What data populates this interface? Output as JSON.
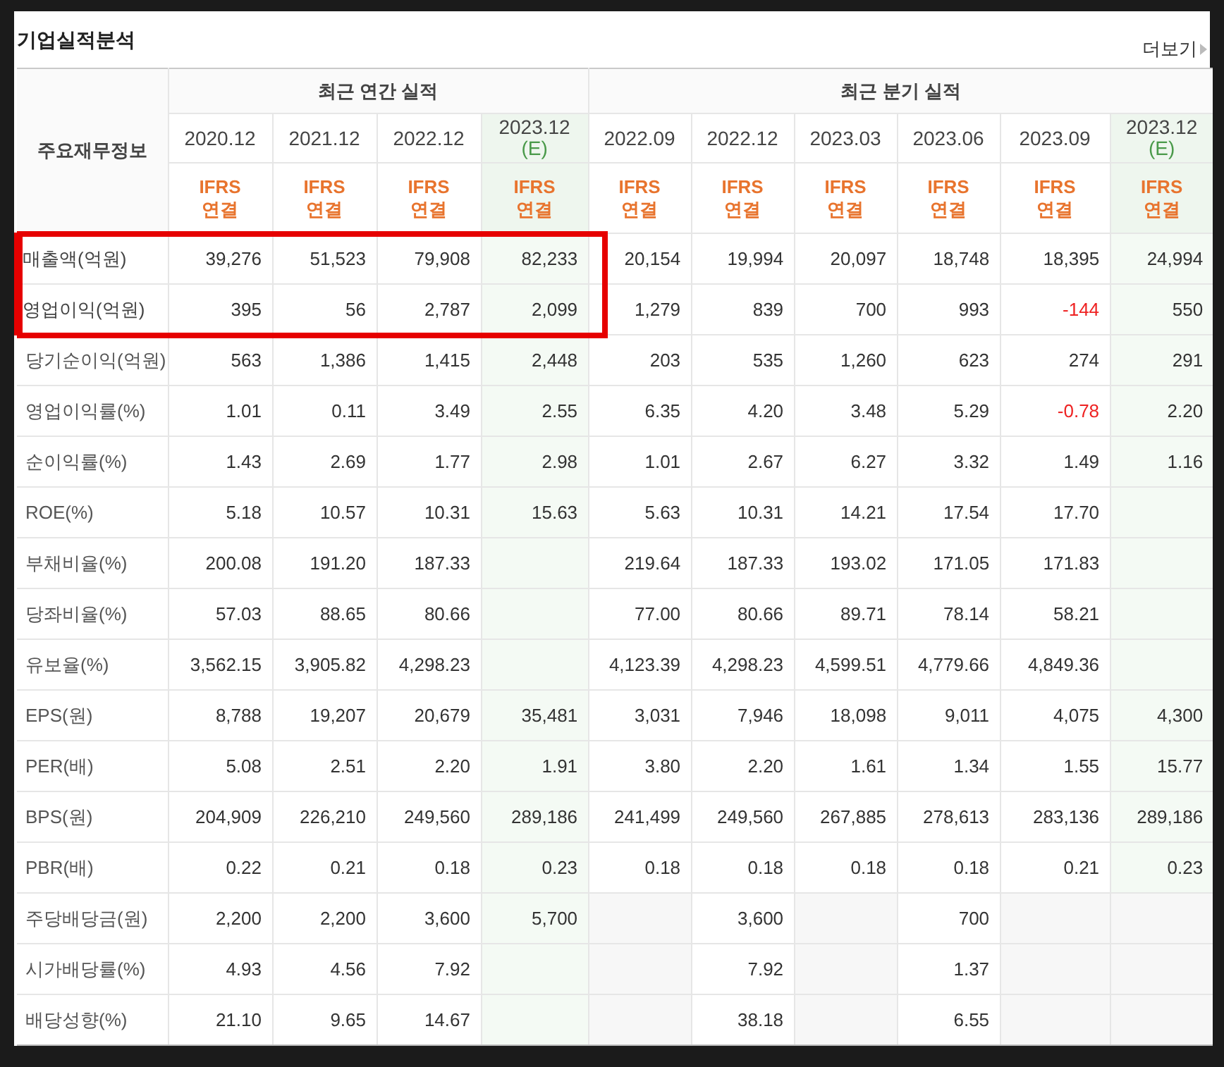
{
  "section": {
    "title": "기업실적분석",
    "more_link": "더보기"
  },
  "table": {
    "corner_label": "주요재무정보",
    "column_groups": [
      {
        "label": "최근 연간 실적",
        "columns": [
          {
            "period": "2020.12",
            "estimate": false,
            "basis": "IFRS 연결"
          },
          {
            "period": "2021.12",
            "estimate": false,
            "basis": "IFRS 연결"
          },
          {
            "period": "2022.12",
            "estimate": false,
            "basis": "IFRS 연결"
          },
          {
            "period": "2023.12",
            "estimate": true,
            "estimate_mark": "(E)",
            "basis": "IFRS 연결"
          }
        ]
      },
      {
        "label": "최근 분기 실적",
        "columns": [
          {
            "period": "2022.09",
            "estimate": false,
            "basis": "IFRS 연결"
          },
          {
            "period": "2022.12",
            "estimate": false,
            "basis": "IFRS 연결"
          },
          {
            "period": "2023.03",
            "estimate": false,
            "basis": "IFRS 연결"
          },
          {
            "period": "2023.06",
            "estimate": false,
            "basis": "IFRS 연결"
          },
          {
            "period": "2023.09",
            "estimate": false,
            "basis": "IFRS 연결"
          },
          {
            "period": "2023.12",
            "estimate": true,
            "estimate_mark": "(E)",
            "basis": "IFRS 연결"
          }
        ]
      }
    ],
    "row_groups": [
      {
        "rows": [
          {
            "label": "매출액(억원)",
            "highlighted": true,
            "values": [
              "39,276",
              "51,523",
              "79,908",
              "82,233",
              "20,154",
              "19,994",
              "20,097",
              "18,748",
              "18,395",
              "24,994"
            ]
          },
          {
            "label": "영업이익(억원)",
            "highlighted": true,
            "values": [
              "395",
              "56",
              "2,787",
              "2,099",
              "1,279",
              "839",
              "700",
              "993",
              {
                "value": "-144",
                "negative": true
              },
              "550"
            ]
          },
          {
            "label": "당기순이익(억원)",
            "highlighted": false,
            "values": [
              "563",
              "1,386",
              "1,415",
              "2,448",
              "203",
              "535",
              "1,260",
              "623",
              "274",
              "291"
            ]
          }
        ]
      },
      {
        "rows": [
          {
            "label": "영업이익률(%)",
            "highlighted": false,
            "values": [
              "1.01",
              "0.11",
              "3.49",
              "2.55",
              "6.35",
              "4.20",
              "3.48",
              "5.29",
              {
                "value": "-0.78",
                "negative": true
              },
              "2.20"
            ]
          },
          {
            "label": "순이익률(%)",
            "highlighted": false,
            "values": [
              "1.43",
              "2.69",
              "1.77",
              "2.98",
              "1.01",
              "2.67",
              "6.27",
              "3.32",
              "1.49",
              "1.16"
            ]
          },
          {
            "label": "ROE(%)",
            "highlighted": false,
            "values": [
              "5.18",
              "10.57",
              "10.31",
              "15.63",
              "5.63",
              "10.31",
              "14.21",
              "17.54",
              "17.70",
              {
                "kind": "blank"
              }
            ]
          }
        ]
      },
      {
        "rows": [
          {
            "label": "부채비율(%)",
            "highlighted": false,
            "values": [
              "200.08",
              "191.20",
              "187.33",
              {
                "kind": "blank"
              },
              "219.64",
              "187.33",
              "193.02",
              "171.05",
              "171.83",
              {
                "kind": "blank"
              }
            ]
          },
          {
            "label": "당좌비율(%)",
            "highlighted": false,
            "values": [
              "57.03",
              "88.65",
              "80.66",
              {
                "kind": "blank"
              },
              "77.00",
              "80.66",
              "89.71",
              "78.14",
              "58.21",
              {
                "kind": "blank"
              }
            ]
          },
          {
            "label": "유보율(%)",
            "highlighted": false,
            "values": [
              "3,562.15",
              "3,905.82",
              "4,298.23",
              {
                "kind": "blank"
              },
              "4,123.39",
              "4,298.23",
              "4,599.51",
              "4,779.66",
              "4,849.36",
              {
                "kind": "blank"
              }
            ]
          }
        ]
      },
      {
        "rows": [
          {
            "label": "EPS(원)",
            "highlighted": false,
            "values": [
              "8,788",
              "19,207",
              "20,679",
              "35,481",
              "3,031",
              "7,946",
              "18,098",
              "9,011",
              "4,075",
              "4,300"
            ]
          },
          {
            "label": "PER(배)",
            "highlighted": false,
            "values": [
              "5.08",
              "2.51",
              "2.20",
              "1.91",
              "3.80",
              "2.20",
              "1.61",
              "1.34",
              "1.55",
              "15.77"
            ]
          },
          {
            "label": "BPS(원)",
            "highlighted": false,
            "values": [
              "204,909",
              "226,210",
              "249,560",
              "289,186",
              "241,499",
              "249,560",
              "267,885",
              "278,613",
              "283,136",
              "289,186"
            ]
          },
          {
            "label": "PBR(배)",
            "highlighted": false,
            "values": [
              "0.22",
              "0.21",
              "0.18",
              "0.23",
              "0.18",
              "0.18",
              "0.18",
              "0.18",
              "0.21",
              "0.23"
            ]
          }
        ]
      },
      {
        "rows": [
          {
            "label": "주당배당금(원)",
            "highlighted": false,
            "values": [
              "2,200",
              "2,200",
              "3,600",
              "5,700",
              {
                "kind": "shaded"
              },
              "3,600",
              {
                "kind": "shaded"
              },
              "700",
              {
                "kind": "shaded"
              },
              {
                "kind": "shaded"
              }
            ]
          },
          {
            "label": "시가배당률(%)",
            "highlighted": false,
            "values": [
              "4.93",
              "4.56",
              "7.92",
              {
                "kind": "blank"
              },
              {
                "kind": "shaded"
              },
              "7.92",
              {
                "kind": "shaded"
              },
              "1.37",
              {
                "kind": "shaded"
              },
              {
                "kind": "shaded"
              }
            ]
          },
          {
            "label": "배당성향(%)",
            "highlighted": false,
            "values": [
              "21.10",
              "9.65",
              "14.67",
              {
                "kind": "blank"
              },
              {
                "kind": "shaded"
              },
              "38.18",
              {
                "kind": "shaded"
              },
              "6.55",
              {
                "kind": "shaded"
              },
              {
                "kind": "shaded"
              }
            ]
          }
        ]
      }
    ]
  }
}
